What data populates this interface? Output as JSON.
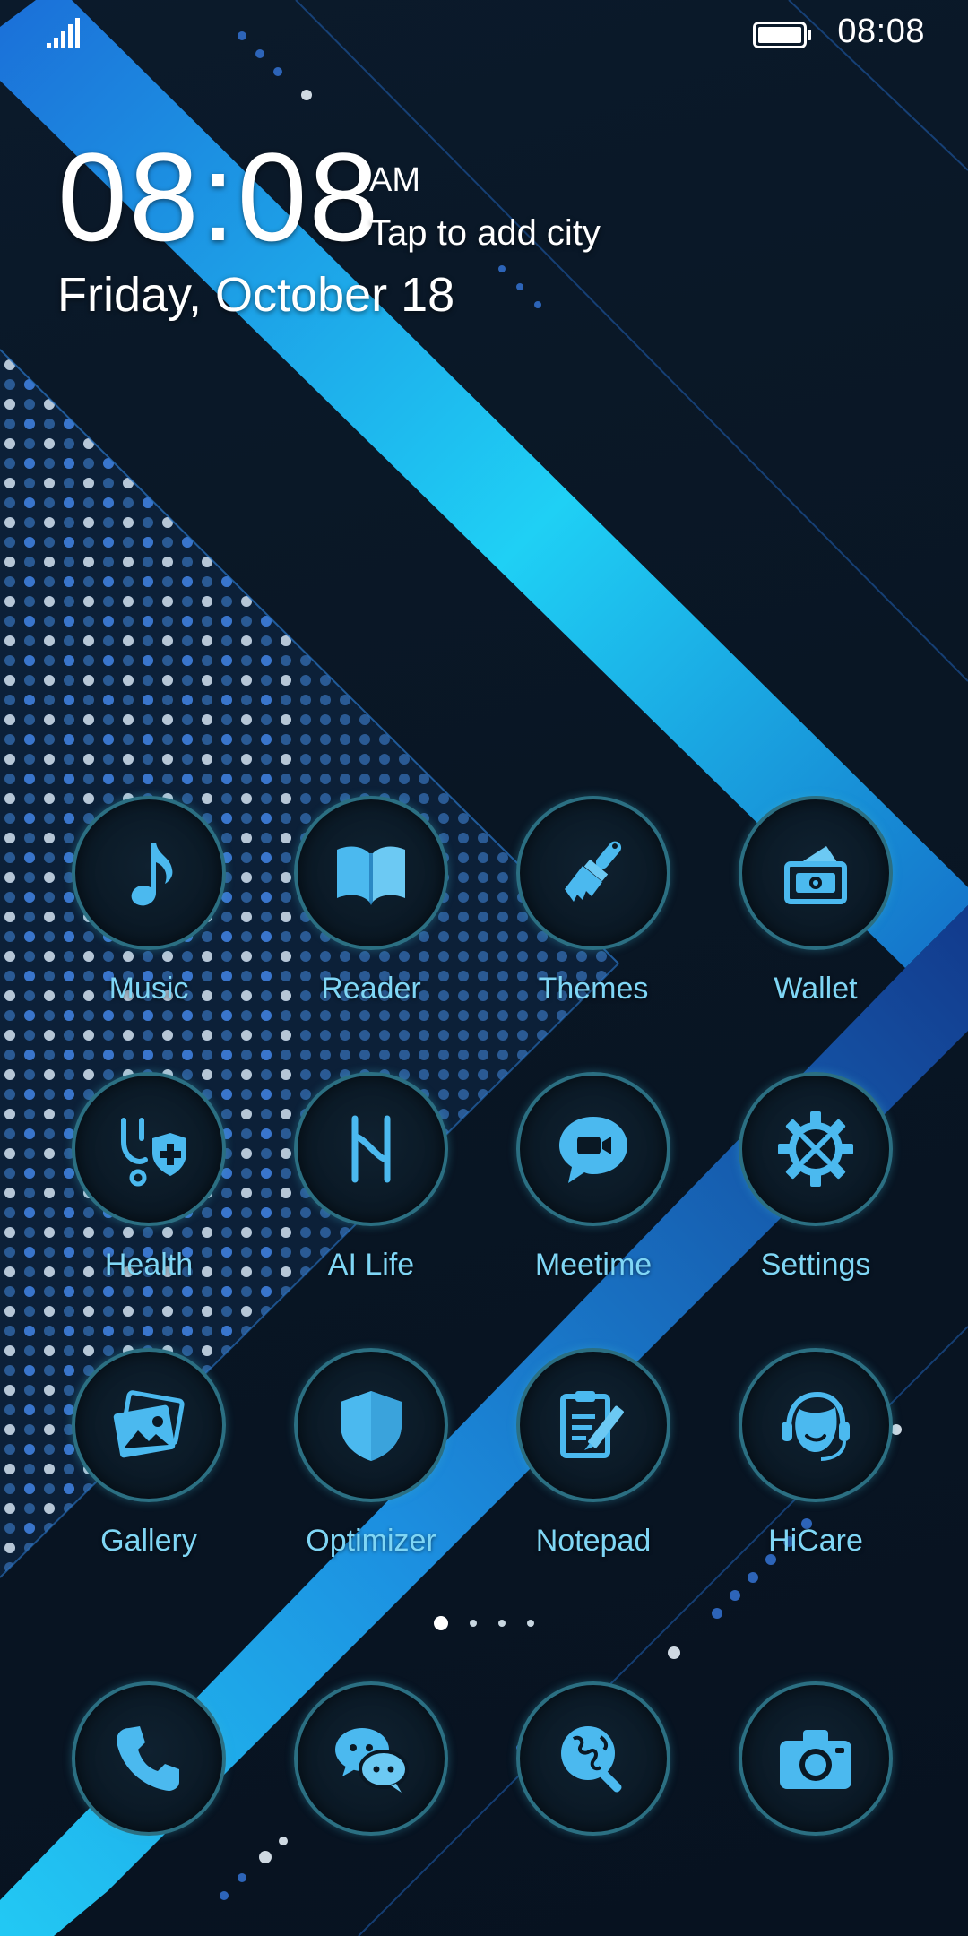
{
  "status_bar": {
    "time": "08:08",
    "signal_icon": "signal-icon",
    "battery_icon": "battery-full-icon"
  },
  "clock_widget": {
    "time": "08:08",
    "ampm": "AM",
    "city_prompt": "Tap to add city",
    "date": "Friday, October 18"
  },
  "apps": [
    {
      "label": "Music",
      "icon": "music-note-icon"
    },
    {
      "label": "Reader",
      "icon": "open-book-icon"
    },
    {
      "label": "Themes",
      "icon": "paintbrush-icon"
    },
    {
      "label": "Wallet",
      "icon": "wallet-icon"
    },
    {
      "label": "Health",
      "icon": "stethoscope-shield-icon"
    },
    {
      "label": "AI Life",
      "icon": "ai-life-icon"
    },
    {
      "label": "Meetime",
      "icon": "video-chat-icon"
    },
    {
      "label": "Settings",
      "icon": "gear-tools-icon"
    },
    {
      "label": "Gallery",
      "icon": "photos-icon"
    },
    {
      "label": "Optimizer",
      "icon": "shield-icon"
    },
    {
      "label": "Notepad",
      "icon": "clipboard-pencil-icon"
    },
    {
      "label": "HiCare",
      "icon": "headset-agent-icon"
    }
  ],
  "dock": [
    {
      "icon": "phone-icon"
    },
    {
      "icon": "chat-bubbles-icon"
    },
    {
      "icon": "globe-search-icon"
    },
    {
      "icon": "camera-icon"
    }
  ],
  "page_indicator": {
    "current": 1,
    "total": 4
  },
  "colors": {
    "accent": "#3fb8ee",
    "label": "#7fd6f5",
    "ring": "#2b6f82",
    "background": "#081522"
  }
}
